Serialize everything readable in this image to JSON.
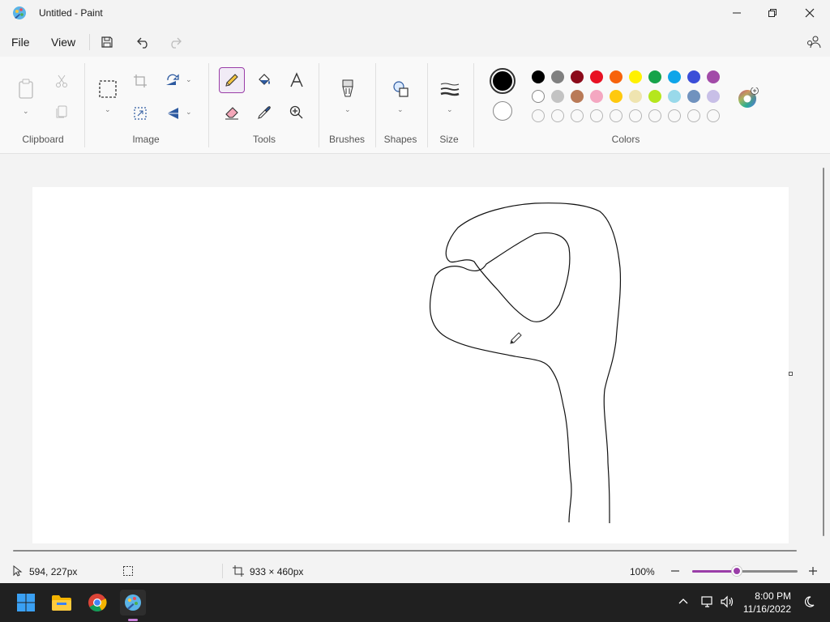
{
  "window": {
    "title": "Untitled - Paint"
  },
  "menu": {
    "file": "File",
    "view": "View"
  },
  "ribbon": {
    "groups": {
      "clipboard": "Clipboard",
      "image": "Image",
      "tools": "Tools",
      "brushes": "Brushes",
      "shapes": "Shapes",
      "size": "Size",
      "colors": "Colors"
    },
    "selected_tool": "pencil"
  },
  "colors": {
    "primary": "#000000",
    "secondary": "#ffffff",
    "palette_row1": [
      "#000000",
      "#808080",
      "#8b0a1a",
      "#e81123",
      "#f7630c",
      "#fff100",
      "#16a34a",
      "#0ea5e9",
      "#3b4ed8",
      "#a24ba8"
    ],
    "palette_row2": [
      "#ffffff",
      "#c3c3c3",
      "#b97a57",
      "#f4a7c1",
      "#ffc90e",
      "#efe4b0",
      "#b5e61d",
      "#99d9ea",
      "#7092be",
      "#c8bfe7"
    ],
    "palette_row3": [
      "empty",
      "empty",
      "empty",
      "empty",
      "empty",
      "empty",
      "empty",
      "empty",
      "empty",
      "empty"
    ],
    "accent": "#9a3ea8"
  },
  "status": {
    "cursor_position": "594, 227px",
    "canvas_size": "933 × 460px",
    "zoom": "100%",
    "zoom_slider_level": 0.42
  },
  "taskbar": {
    "time": "8:00 PM",
    "date": "11/16/2022"
  }
}
